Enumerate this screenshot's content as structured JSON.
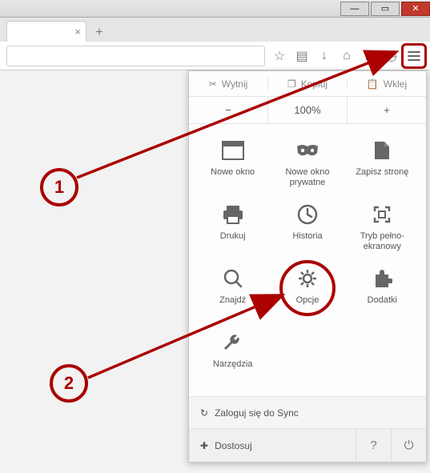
{
  "window": {
    "close": "✕",
    "max": "▭",
    "min": "—"
  },
  "tabs": {
    "close": "×",
    "new": "+"
  },
  "toolbar": {
    "star": "☆",
    "reader": "▤",
    "download": "↓",
    "home": "⌂",
    "send": "➤",
    "history": "◷",
    "menu": "≡"
  },
  "menu": {
    "edit": {
      "cut": "Wytnij",
      "copy": "Kopiuj",
      "paste": "Wklej"
    },
    "zoom": {
      "minus": "−",
      "level": "100%",
      "plus": "+"
    },
    "items": [
      {
        "name": "new-window",
        "label": "Nowe okno"
      },
      {
        "name": "private",
        "label": "Nowe okno prywatne"
      },
      {
        "name": "save-page",
        "label": "Zapisz stronę"
      },
      {
        "name": "print",
        "label": "Drukuj"
      },
      {
        "name": "history",
        "label": "Historia"
      },
      {
        "name": "fullscreen",
        "label": "Tryb pełno-ekranowy"
      },
      {
        "name": "find",
        "label": "Znajdź"
      },
      {
        "name": "options",
        "label": "Opcje"
      },
      {
        "name": "addons",
        "label": "Dodatki"
      },
      {
        "name": "devtools",
        "label": "Narzędzia"
      }
    ],
    "sync": "Zaloguj się do Sync",
    "customize": "Dostosuj",
    "help": "?",
    "power": "⏻"
  },
  "callouts": {
    "one": "1",
    "two": "2"
  }
}
